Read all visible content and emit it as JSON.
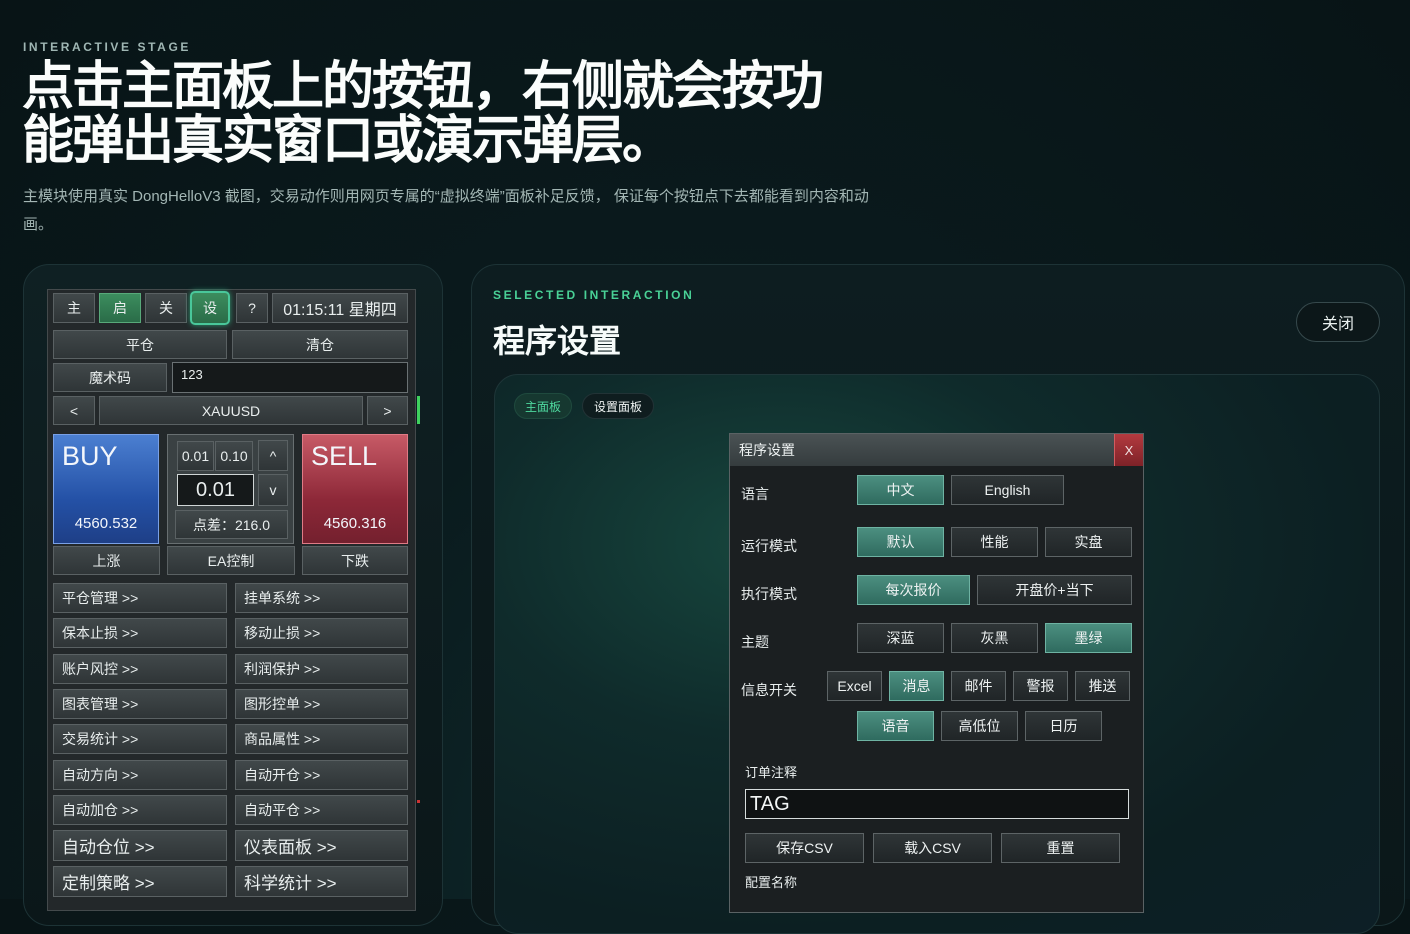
{
  "header": {
    "eyebrow": "INTERACTIVE STAGE",
    "headline_line1": "点击主面板上的按钮，右侧就会按功",
    "headline_line2": "能弹出真实窗口或演示弹层。",
    "subtitle": "主模块使用真实 DongHelloV3 截图，交易动作则用网页专属的“虚拟终端”面板补足反馈， 保证每个按钮点下去都能看到内容和动画。"
  },
  "terminal": {
    "top_buttons": [
      "主",
      "启",
      "关",
      "设",
      "?"
    ],
    "clock": "01:15:11 星期四",
    "close_pos": "平仓",
    "clear_pos": "清仓",
    "magic_label": "魔术码",
    "magic_value": "123",
    "prev": "<",
    "symbol": "XAUUSD",
    "next": ">",
    "buy": {
      "label": "BUY",
      "price": "4560.532",
      "caption": "上涨"
    },
    "sell": {
      "label": "SELL",
      "price": "4560.316",
      "caption": "下跌"
    },
    "lot_small": "0.01",
    "lot_medium": "0.10",
    "lot_value": "0.01",
    "lot_up": "^",
    "lot_down": "v",
    "spread": "点差：216.0",
    "ea_control": "EA控制",
    "menu_left": [
      "平仓管理 >>",
      "保本止损 >>",
      "账户风控 >>",
      "图表管理 >>",
      "交易统计 >>",
      "自动方向 >>",
      "自动加仓 >>",
      "自动仓位 >>",
      "定制策略 >>"
    ],
    "menu_right": [
      "挂单系统 >>",
      "移动止损 >>",
      "利润保护 >>",
      "图形控单 >>",
      "商品属性 >>",
      "自动开仓 >>",
      "自动平仓 >>",
      "仪表面板 >>",
      "科学统计 >>"
    ]
  },
  "selected": {
    "eyebrow": "SELECTED INTERACTION",
    "title": "程序设置",
    "close": "关闭",
    "pill_main": "主面板",
    "pill_settings": "设置面板"
  },
  "dialog": {
    "title": "程序设置",
    "close_x": "X",
    "language_label": "语言",
    "language_options": [
      "中文",
      "English"
    ],
    "run_mode_label": "运行模式",
    "run_mode_options": [
      "默认",
      "性能",
      "实盘"
    ],
    "exec_mode_label": "执行模式",
    "exec_mode_options": [
      "每次报价",
      "开盘价+当下"
    ],
    "theme_label": "主题",
    "theme_options": [
      "深蓝",
      "灰黑",
      "墨绿"
    ],
    "info_label": "信息开关",
    "info_options_row1": [
      "Excel",
      "消息",
      "邮件",
      "警报",
      "推送"
    ],
    "info_options_row2": [
      "语音",
      "高低位",
      "日历"
    ],
    "order_comment_label": "订单注释",
    "order_comment_value": "TAG",
    "save_csv": "保存CSV",
    "load_csv": "载入CSV",
    "reset": "重置",
    "config_name_label": "配置名称"
  }
}
